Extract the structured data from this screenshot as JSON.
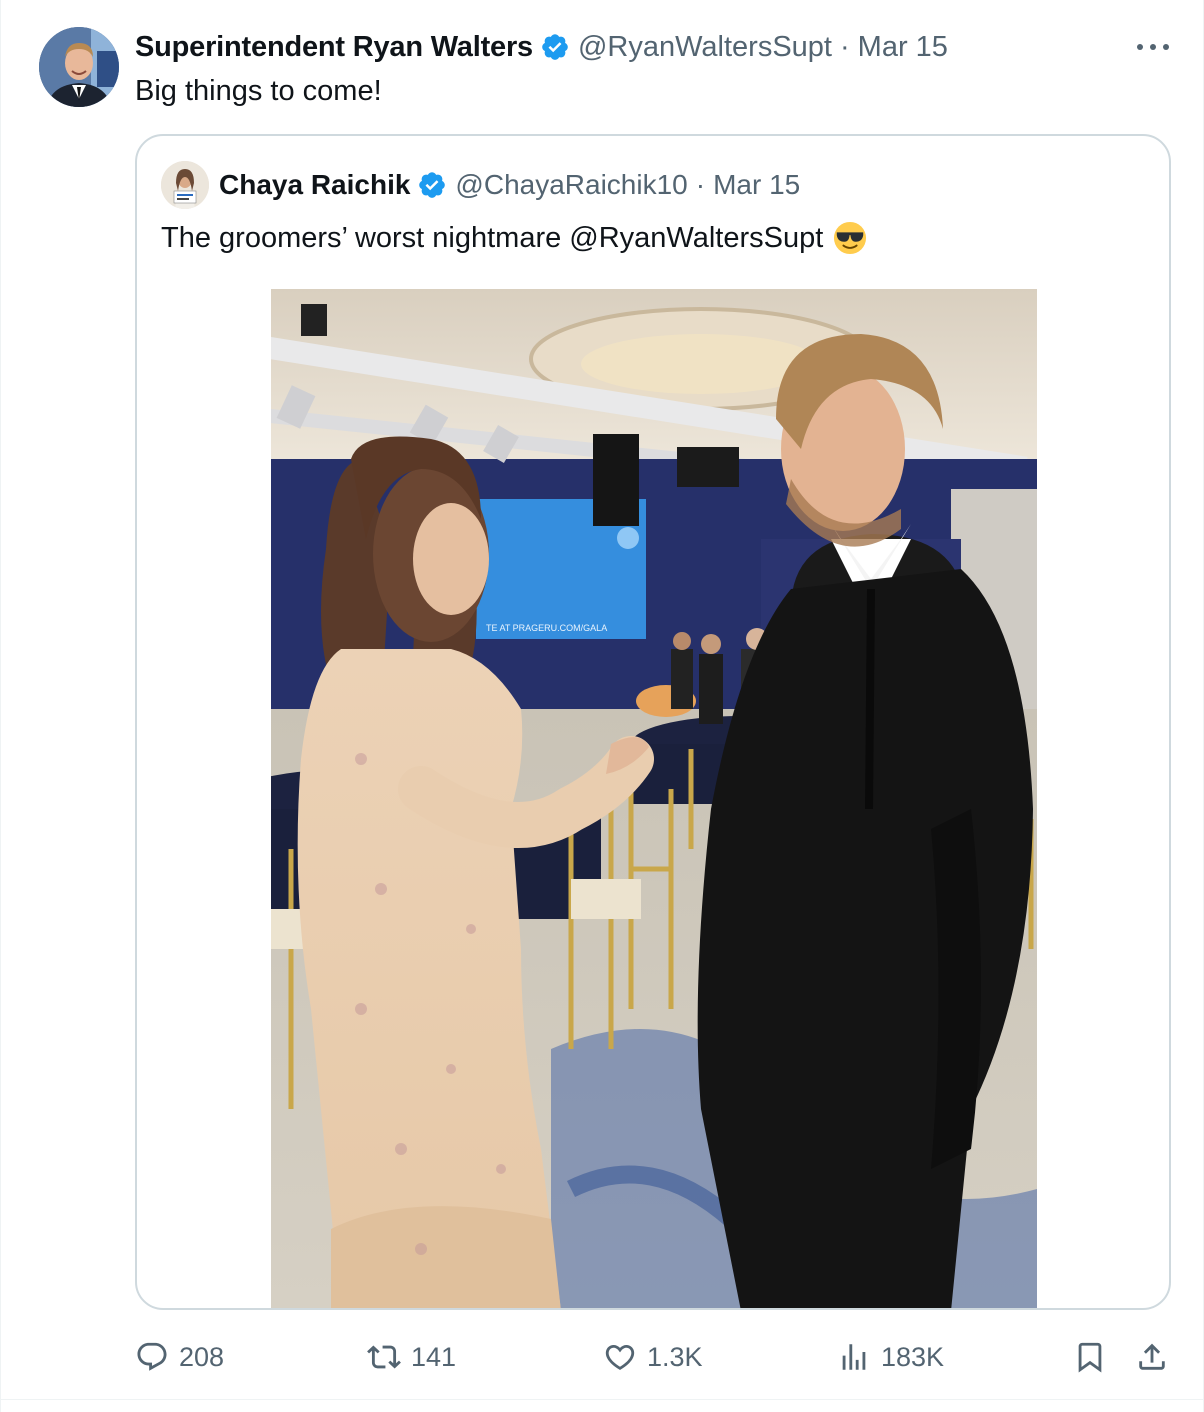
{
  "tweet": {
    "author_name": "Superintendent Ryan Walters",
    "handle": "@RyanWaltersSupt",
    "separator": "·",
    "date": "Mar 15",
    "text": "Big things to come!"
  },
  "quoted_tweet": {
    "author_name": "Chaya Raichik",
    "handle": "@ChayaRaichik10",
    "separator": "·",
    "date": "Mar 15",
    "text": "The groomers’ worst nightmare @RyanWaltersSupt",
    "emoji": "smiling-face-with-sunglasses",
    "photo": {
      "screen_text": "TE AT PRAGERU.COM/GALA"
    }
  },
  "actions": {
    "replies": "208",
    "reposts": "141",
    "likes": "1.3K",
    "views": "183K"
  },
  "colors": {
    "text_primary": "#0f1419",
    "text_secondary": "#536471",
    "verified_blue": "#1d9bf0",
    "border": "#cfd9de"
  }
}
